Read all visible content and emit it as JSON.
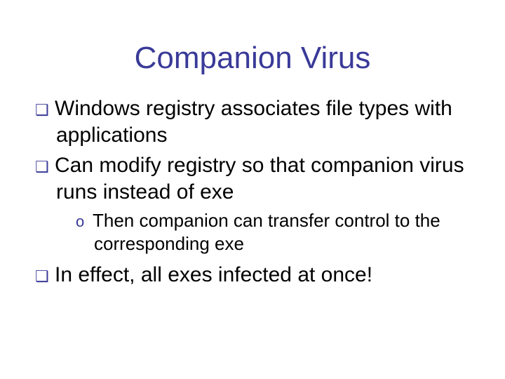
{
  "title": "Companion Virus",
  "bullets": {
    "b1": "Windows registry associates file types with applications",
    "b2": "Can modify registry so that companion virus runs instead of exe",
    "b2_sub1": "Then companion can transfer control to the corresponding exe",
    "b3": "In effect, all exes infected at once!"
  },
  "markers": {
    "square": "❑",
    "circle": "o"
  }
}
